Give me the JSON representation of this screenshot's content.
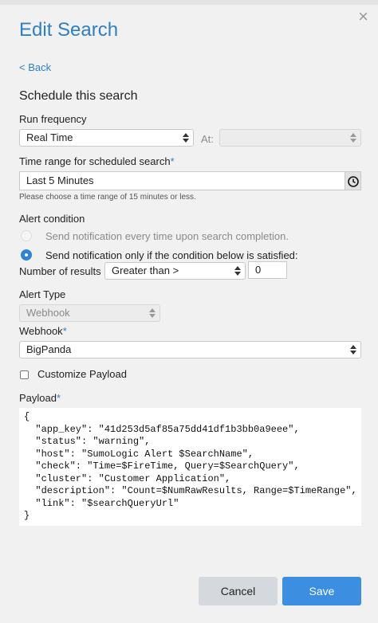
{
  "dialog": {
    "title": "Edit Search",
    "back_label": "< Back",
    "close_label": "×"
  },
  "schedule": {
    "section_title": "Schedule this search",
    "run_frequency_label": "Run frequency",
    "run_frequency_value": "Real Time",
    "at_label": "At:",
    "at_value": "",
    "time_range_label": "Time range for scheduled search",
    "time_range_value": "Last 5 Minutes",
    "time_range_hint": "Please choose a time range of 15 minutes or less."
  },
  "alert": {
    "condition_label": "Alert condition",
    "option_every_time": "Send notification every time upon search completion.",
    "option_condition": "Send notification only if the condition below is satisfied:",
    "number_of_results_label": "Number of results",
    "comparison_value": "Greater than >",
    "threshold_value": "0",
    "type_label": "Alert Type",
    "type_value": "Webhook",
    "webhook_label": "Webhook",
    "webhook_value": "BigPanda",
    "customize_payload_label": "Customize Payload",
    "payload_label": "Payload",
    "payload_text": "{\n  \"app_key\": \"41d253d5af85a75dd41df1b3bb0a9eee\",\n  \"status\": \"warning\",\n  \"host\": \"SumoLogic Alert $SearchName\",\n  \"check\": \"Time=$FireTime, Query=$SearchQuery\",\n  \"cluster\": \"Customer Application\",\n  \"description\": \"Count=$NumRawResults, Range=$TimeRange\",\n  \"link\": \"$searchQueryUrl\"\n}"
  },
  "footer": {
    "cancel_label": "Cancel",
    "save_label": "Save"
  },
  "colors": {
    "accent": "#2f7fc1",
    "save_button": "#3b8ee0",
    "cancel_button": "#d5d9de",
    "background": "#f1f1f1"
  },
  "icons": {
    "close": "close-icon",
    "clock": "clock-icon",
    "select_arrows": "select-arrows-icon"
  }
}
